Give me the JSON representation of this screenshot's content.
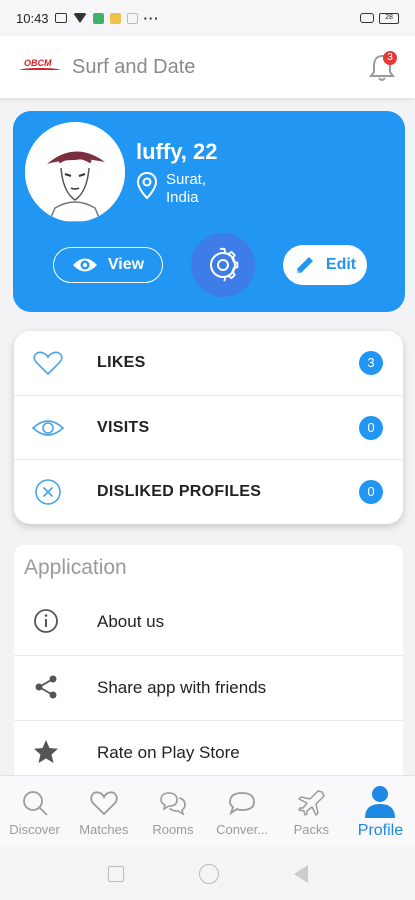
{
  "status_bar": {
    "time": "10:43",
    "battery": "28"
  },
  "app_bar": {
    "logo_text": "OBCM",
    "title": "Surf and Date",
    "notification_count": "3"
  },
  "profile": {
    "name_age": "luffy, 22",
    "location_line1": "Surat,",
    "location_line2": "India",
    "view_label": "View",
    "edit_label": "Edit",
    "accent_color": "#2196f3"
  },
  "stats": [
    {
      "label": "LIKES",
      "count": "3",
      "icon": "heart-outline-icon"
    },
    {
      "label": "VISITS",
      "count": "0",
      "icon": "eye-outline-icon"
    },
    {
      "label": "DISLIKED PROFILES",
      "count": "0",
      "icon": "close-circle-icon"
    }
  ],
  "application": {
    "title": "Application",
    "items": [
      {
        "label": "About us",
        "icon": "info-icon"
      },
      {
        "label": "Share app with friends",
        "icon": "share-icon"
      },
      {
        "label": "Rate on Play Store",
        "icon": "star-icon"
      }
    ]
  },
  "bottom_nav": [
    {
      "label": "Discover",
      "icon": "search-icon"
    },
    {
      "label": "Matches",
      "icon": "heart-icon"
    },
    {
      "label": "Rooms",
      "icon": "chat-bubbles-icon"
    },
    {
      "label": "Conver...",
      "icon": "chat-bubble-icon"
    },
    {
      "label": "Packs",
      "icon": "plane-icon"
    },
    {
      "label": "Profile",
      "icon": "person-icon",
      "active": true
    }
  ]
}
